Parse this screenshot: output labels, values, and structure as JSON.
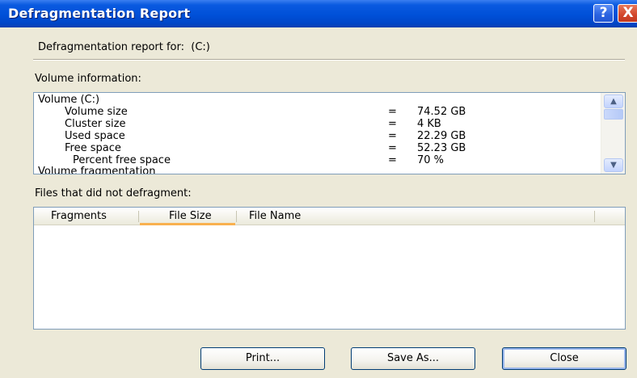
{
  "window": {
    "title": "Defragmentation Report",
    "help_glyph": "?",
    "close_glyph": "X"
  },
  "report_for": {
    "label": "Defragmentation report for:",
    "drive": "(C:)"
  },
  "volume_info": {
    "label": "Volume information:",
    "rows": [
      {
        "key": "Volume  (C:)",
        "eq": "",
        "value": ""
      },
      {
        "key": "Volume size",
        "eq": "=",
        "value": "74.52 GB"
      },
      {
        "key": "Cluster size",
        "eq": "=",
        "value": "4 KB"
      },
      {
        "key": "Used space",
        "eq": "=",
        "value": "22.29 GB"
      },
      {
        "key": "Free space",
        "eq": "=",
        "value": "52.23 GB"
      },
      {
        "key": "Percent free space",
        "eq": "=",
        "value": "70 %"
      },
      {
        "key": "Volume fragmentation",
        "eq": "",
        "value": ""
      }
    ]
  },
  "files_not_defragmented": {
    "label": "Files that did not defragment:",
    "columns": [
      "Fragments",
      "File Size",
      "File Name"
    ],
    "rows": []
  },
  "buttons": {
    "print": "Print...",
    "save_as": "Save As...",
    "close": "Close"
  },
  "colors": {
    "titlebar": "#0050d8",
    "dialog_bg": "#ece9d8",
    "close_button": "#d2452a",
    "list_border": "#7f9db9",
    "active_column_underline": "#f9b14f"
  },
  "icons": {
    "scroll_up": "chevron-up-icon",
    "scroll_down": "chevron-down-icon"
  }
}
